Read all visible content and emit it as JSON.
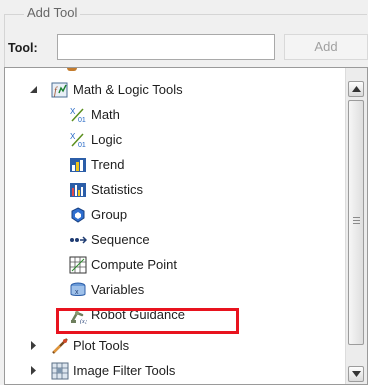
{
  "group": {
    "title": "Add Tool"
  },
  "tool_field": {
    "label": "Tool:",
    "value": "",
    "placeholder": ""
  },
  "add_button": {
    "label": "Add",
    "enabled": false
  },
  "tree": {
    "category": "Math & Logic Tools",
    "children": [
      {
        "label": "Math",
        "icon": "math-icon"
      },
      {
        "label": "Logic",
        "icon": "logic-icon"
      },
      {
        "label": "Trend",
        "icon": "trend-chart-icon"
      },
      {
        "label": "Statistics",
        "icon": "statistics-chart-icon"
      },
      {
        "label": "Group",
        "icon": "group-icon"
      },
      {
        "label": "Sequence",
        "icon": "sequence-icon"
      },
      {
        "label": "Compute Point",
        "icon": "compute-point-icon"
      },
      {
        "label": "Variables",
        "icon": "variables-icon"
      },
      {
        "label": "Robot Guidance",
        "icon": "robot-guidance-icon"
      }
    ],
    "collapsed": [
      {
        "label": "Plot Tools",
        "icon": "plot-tools-icon"
      },
      {
        "label": "Image Filter Tools",
        "icon": "image-filter-icon"
      }
    ]
  },
  "highlight": {
    "target": "Robot Guidance",
    "color": "#e8131e"
  }
}
